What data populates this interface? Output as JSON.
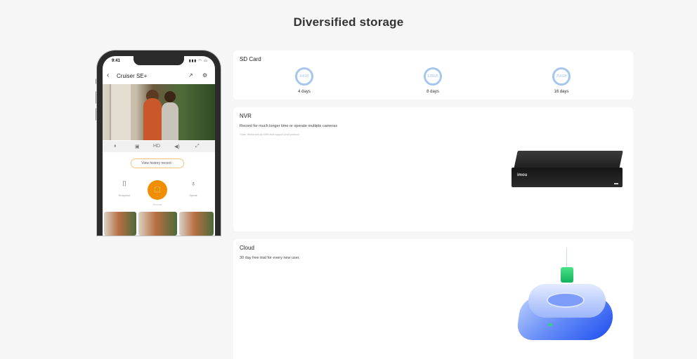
{
  "page": {
    "title": "Diversified storage"
  },
  "phone": {
    "status_time": "9:41",
    "device_name": "Cruiser SE+",
    "history_button": "View  history record",
    "actions": [
      {
        "label": "Snapshot",
        "icon": "camera-icon"
      },
      {
        "label": "Record",
        "icon": "video-icon"
      },
      {
        "label": "Speak",
        "icon": "microphone-icon"
      }
    ],
    "quality_label": "HD",
    "accent_color": "#f18d00"
  },
  "sd_card": {
    "title": "SD Card",
    "options": [
      {
        "capacity": "64GB",
        "days": "4 days"
      },
      {
        "capacity": "128GB",
        "days": "8 days"
      },
      {
        "capacity": "256GB",
        "days": "16 days"
      }
    ],
    "ring_color": "#a7c6ee"
  },
  "nvr": {
    "title": "NVR",
    "description": "Record for much longer time or operate multiple cameras",
    "note": "*Note: Works with all NVRs that support Onvif protocol.",
    "device_logo": "imou"
  },
  "cloud": {
    "title": "Cloud",
    "description": "30  day free trial for every new user."
  }
}
